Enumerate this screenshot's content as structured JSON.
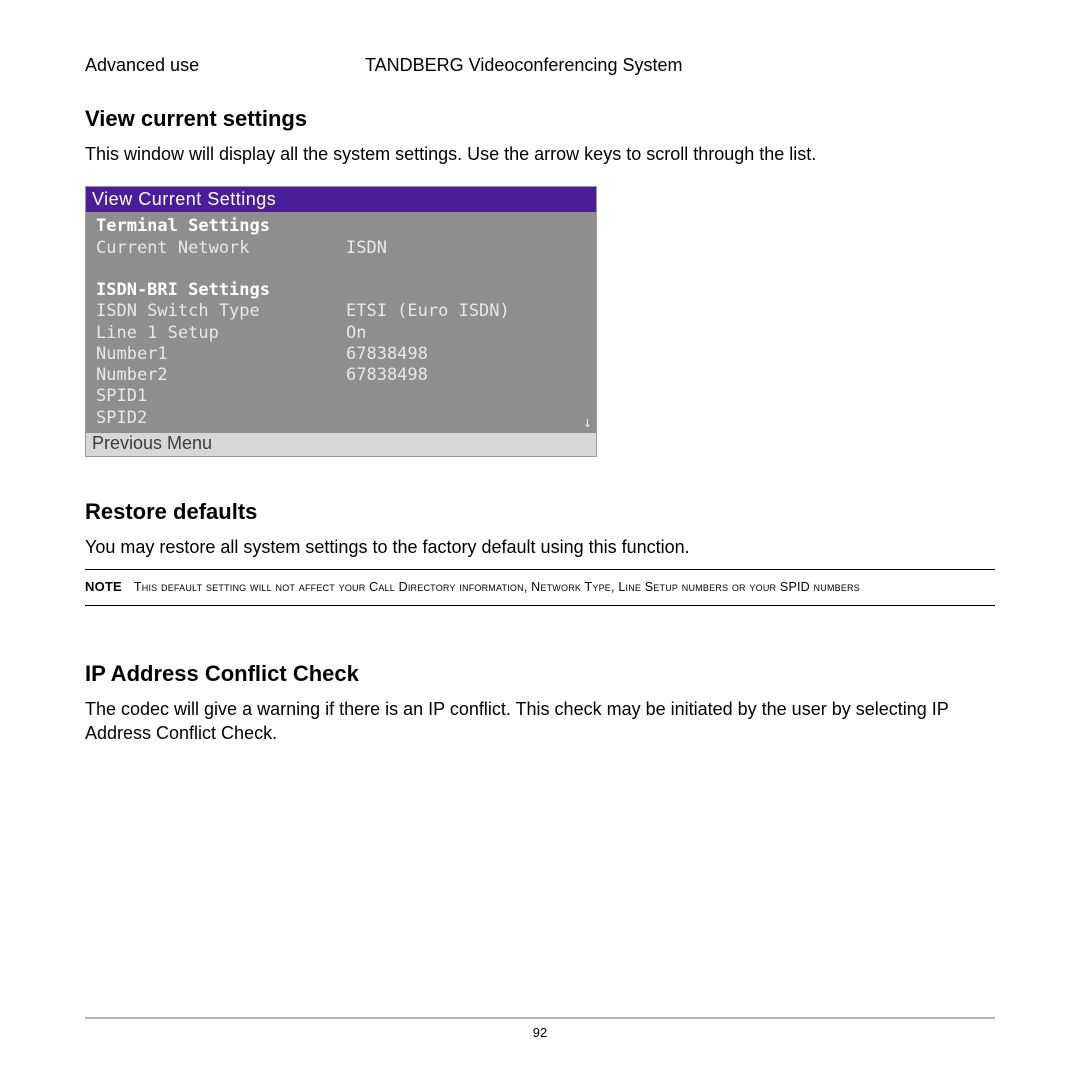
{
  "header": {
    "section": "Advanced use",
    "product": "TANDBERG Videoconferencing System"
  },
  "view_settings": {
    "title": "View current settings",
    "desc": "This window will display all the system settings. Use the arrow keys to scroll through the list."
  },
  "panel": {
    "title": "View Current Settings",
    "terminal_heading": "Terminal Settings",
    "rows1": [
      {
        "label": "Current Network",
        "value": "ISDN"
      }
    ],
    "isdn_heading": "ISDN-BRI Settings",
    "rows2": [
      {
        "label": "ISDN Switch Type",
        "value": "ETSI (Euro ISDN)"
      },
      {
        "label": "Line 1 Setup",
        "value": "On"
      },
      {
        "label": "Number1",
        "value": "67838498"
      },
      {
        "label": "Number2",
        "value": "67838498"
      },
      {
        "label": "SPID1",
        "value": ""
      },
      {
        "label": "SPID2",
        "value": ""
      }
    ],
    "scroll_arrow": "↓",
    "footer": "Previous Menu"
  },
  "restore": {
    "title": "Restore defaults",
    "desc": "You may restore all system settings to the factory default using this function.",
    "note_label": "NOTE",
    "note_text": "This default setting will not affect your Call Directory information, Network Type, Line Setup numbers or your SPID numbers"
  },
  "ipcheck": {
    "title": "IP Address Conflict Check",
    "desc": "The codec will give a warning if there is an IP conflict. This check may be initiated by the user by selecting IP Address Conflict Check."
  },
  "page_number": "92"
}
